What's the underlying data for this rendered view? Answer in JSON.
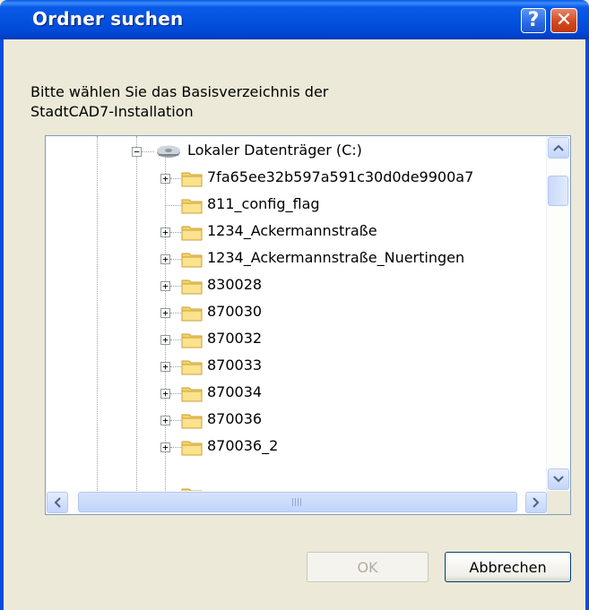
{
  "dialog": {
    "title": "Ordner suchen",
    "help_label": "?",
    "close_label": "✕"
  },
  "prompt": {
    "text": "Bitte wählen Sie das Basisverzeichnis der\nStadtCAD7-Installation"
  },
  "tree": {
    "root_item": {
      "label": "Lokaler Datenträger (C:)",
      "expanded": true,
      "icon": "drive-icon"
    },
    "items": [
      {
        "label": "7fa65ee32b597a591c30d0de9900a7",
        "has_children": true
      },
      {
        "label": "811_config_flag",
        "has_children": false
      },
      {
        "label": "1234_Ackermannstraße",
        "has_children": true
      },
      {
        "label": "1234_Ackermannstraße_Nuertingen",
        "has_children": true
      },
      {
        "label": "830028",
        "has_children": true
      },
      {
        "label": "870030",
        "has_children": true
      },
      {
        "label": "870032",
        "has_children": true
      },
      {
        "label": "870033",
        "has_children": true
      },
      {
        "label": "870034",
        "has_children": true
      },
      {
        "label": "870036",
        "has_children": true
      },
      {
        "label": "870036_2",
        "has_children": true
      }
    ],
    "expander_plus": "+",
    "expander_minus": "−"
  },
  "buttons": {
    "ok_label": "OK",
    "cancel_label": "Abbrechen",
    "ok_enabled": false
  },
  "colors": {
    "titlebar": "#0452e0",
    "dialog_bg": "#ece9d8",
    "folder": "#f4d266"
  }
}
